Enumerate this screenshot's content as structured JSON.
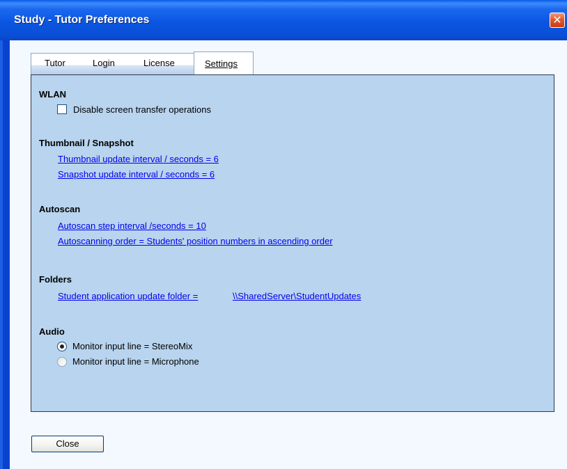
{
  "window": {
    "title": "Study - Tutor Preferences",
    "close_glyph": "✕"
  },
  "tabs": [
    {
      "label": "Tutor"
    },
    {
      "label": "Login"
    },
    {
      "label": "License"
    },
    {
      "label": "Settings"
    }
  ],
  "selected_tab": "Settings",
  "sections": {
    "wlan": {
      "title": "WLAN",
      "checkbox_label": "Disable screen transfer operations",
      "checkbox_checked": false
    },
    "thumbnail": {
      "title": "Thumbnail / Snapshot",
      "thumbnail_link": "Thumbnail update interval / seconds =  6",
      "snapshot_link": "Snapshot update interval / seconds =  6"
    },
    "autoscan": {
      "title": "Autoscan",
      "step_link": "Autoscan step interval /seconds = 10",
      "order_link": "Autoscanning  order = Students' position numbers  in  ascending order"
    },
    "folders": {
      "title": "Folders",
      "folder_link": "Student application update folder =",
      "folder_path_link": "\\\\SharedServer\\StudentUpdates"
    },
    "audio": {
      "title": "Audio",
      "option_stereomix": "Monitor input line = StereoMix",
      "option_microphone": "Monitor input line = Microphone",
      "selected": "StereoMix"
    }
  },
  "buttons": {
    "close_label": "Close"
  },
  "colors": {
    "titlebar": "#0a55e0",
    "panel_bg": "#b8d4ee",
    "link": "#0000ee",
    "close_icon": "#e15a2e"
  }
}
